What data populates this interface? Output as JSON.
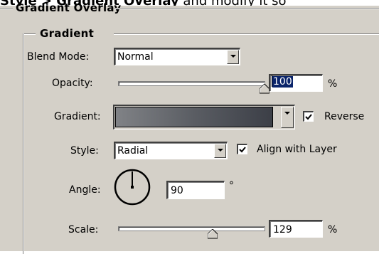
{
  "caption": {
    "bold_text": "Style > Gradient Overlay",
    "rest_text": " and modify it so"
  },
  "group_outer": {
    "title": "Gradient Overlay"
  },
  "group_inner": {
    "title": "Gradient"
  },
  "blend_mode": {
    "label": "Blend Mode:",
    "value": "Normal"
  },
  "opacity": {
    "label": "Opacity:",
    "value": "100",
    "unit": "%",
    "level": 1.0
  },
  "gradient": {
    "label": "Gradient:",
    "reverse_label": "Reverse",
    "reverse_checked": true,
    "colors": [
      "#808286",
      "#5a5d63",
      "#3c3f47"
    ]
  },
  "style": {
    "label": "Style:",
    "value": "Radial",
    "align_label": "Align with Layer",
    "align_checked": true
  },
  "angle": {
    "label": "Angle:",
    "value": "90",
    "unit": "°",
    "degrees": 90
  },
  "scale": {
    "label": "Scale:",
    "value": "129",
    "unit": "%",
    "level_percent": 129
  },
  "colors": {
    "panel_bg": "#d4d0c8",
    "selection": "#0a246a"
  }
}
